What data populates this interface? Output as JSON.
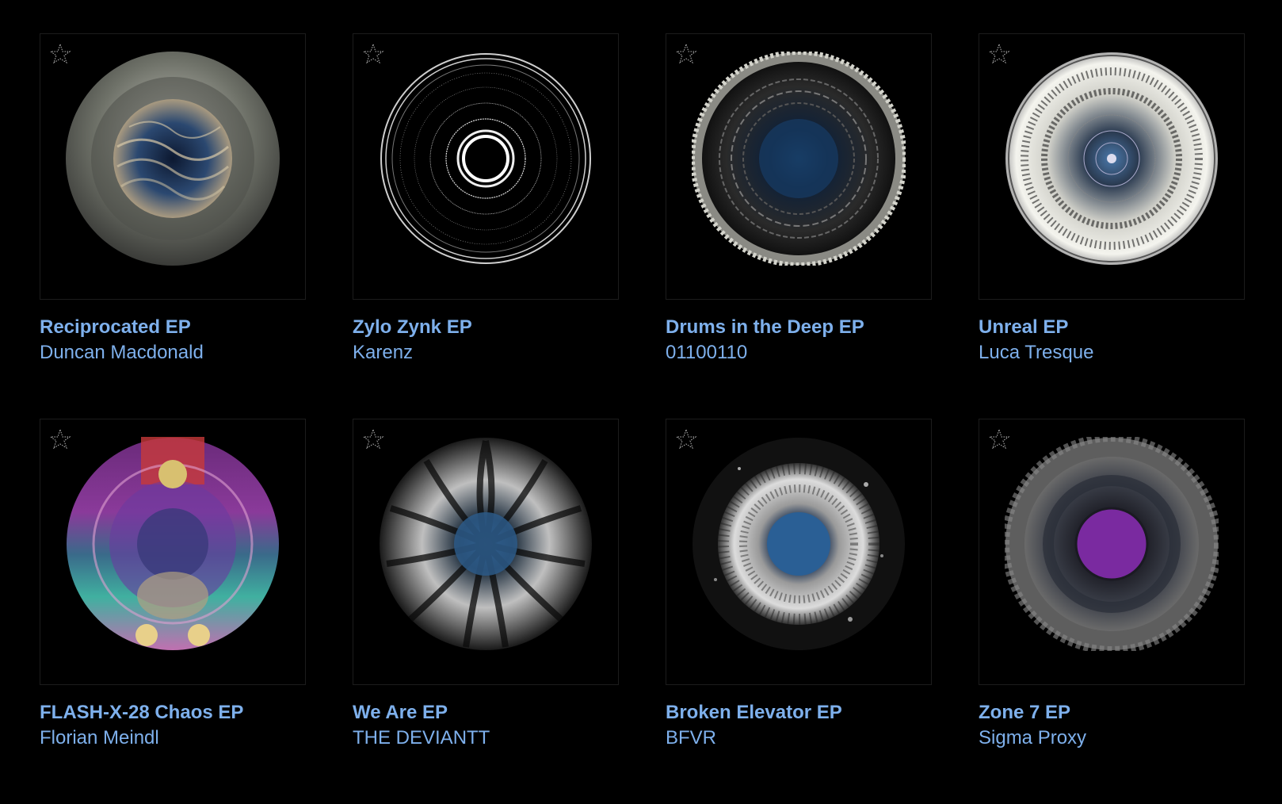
{
  "releases": [
    {
      "title": "Reciprocated EP",
      "artist": "Duncan Macdonald",
      "art": "grey-marble-rings",
      "accent": "#3a5a8a"
    },
    {
      "title": "Zylo Zynk EP",
      "artist": "Karenz",
      "art": "white-line-rings",
      "accent": "#ffffff"
    },
    {
      "title": "Drums in the Deep EP",
      "artist": "01100110",
      "art": "rippled-drum-blue-core",
      "accent": "#1f4f80"
    },
    {
      "title": "Unreal EP",
      "artist": "Luca Tresque",
      "art": "white-burst-blue-core",
      "accent": "#3a6aa0"
    },
    {
      "title": "FLASH-X-28 Chaos EP",
      "artist": "Florian Meindl",
      "art": "psychedelic-colour-rings",
      "accent": "#b04a8a"
    },
    {
      "title": "We Are EP",
      "artist": "THE DEVIANTT",
      "art": "ribbed-sphere-blue-core",
      "accent": "#2a5a8a"
    },
    {
      "title": "Broken Elevator EP",
      "artist": "BFVR",
      "art": "iris-blue-core",
      "accent": "#2b5f95"
    },
    {
      "title": "Zone 7 EP",
      "artist": "Sigma Proxy",
      "art": "rock-rings-purple-core",
      "accent": "#8a2aa0"
    }
  ],
  "logo_icon": "star-icon"
}
